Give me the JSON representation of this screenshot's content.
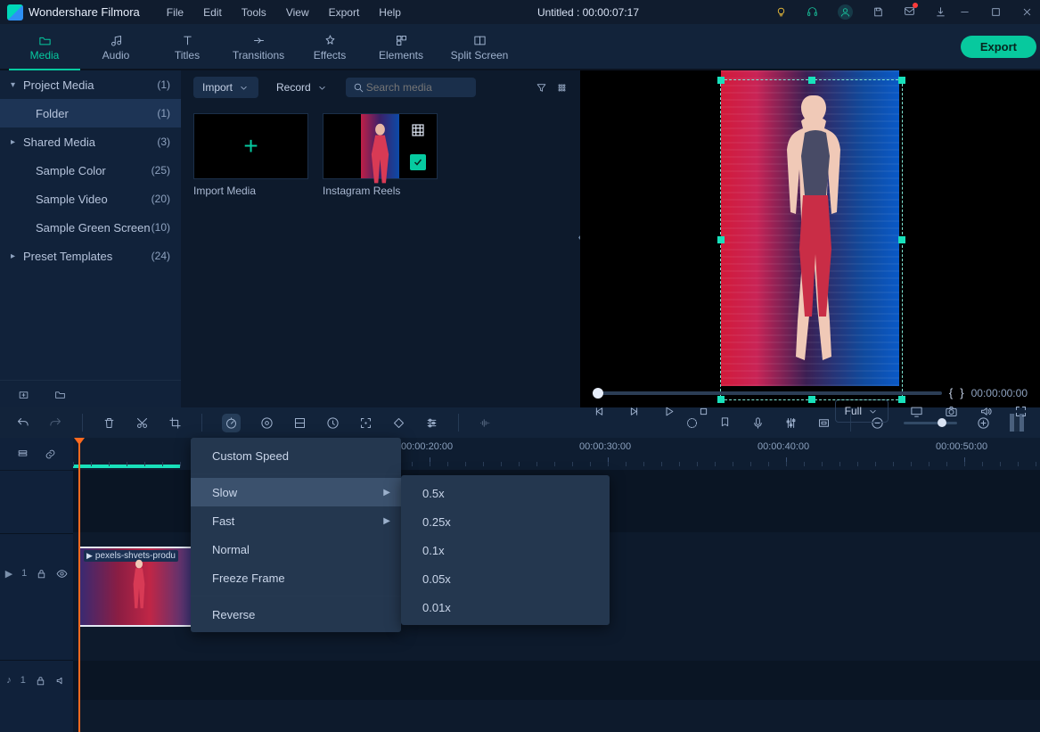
{
  "app_name": "Wondershare Filmora",
  "menus": [
    "File",
    "Edit",
    "Tools",
    "View",
    "Export",
    "Help"
  ],
  "project_title": "Untitled : 00:00:07:17",
  "cats": [
    {
      "label": "Media",
      "active": true
    },
    {
      "label": "Audio"
    },
    {
      "label": "Titles"
    },
    {
      "label": "Transitions"
    },
    {
      "label": "Effects"
    },
    {
      "label": "Elements"
    },
    {
      "label": "Split Screen"
    }
  ],
  "export_label": "Export",
  "leftpanel": [
    {
      "tri": "▾",
      "name": "Project Media",
      "count": "(1)",
      "hdr": true
    },
    {
      "tri": "",
      "name": "Folder",
      "count": "(1)",
      "sub": true,
      "sel": true
    },
    {
      "tri": "▸",
      "name": "Shared Media",
      "count": "(3)",
      "hdr": true
    },
    {
      "tri": "",
      "name": "Sample Color",
      "count": "(25)",
      "sub": true
    },
    {
      "tri": "",
      "name": "Sample Video",
      "count": "(20)",
      "sub": true
    },
    {
      "tri": "",
      "name": "Sample Green Screen",
      "count": "(10)",
      "sub": true
    },
    {
      "tri": "▸",
      "name": "Preset Templates",
      "count": "(24)",
      "hdr": true
    }
  ],
  "media_bar": {
    "import": "Import",
    "record": "Record",
    "search_ph": "Search media"
  },
  "thumbs": [
    {
      "type": "import",
      "label": "Import Media"
    },
    {
      "type": "clip",
      "label": "Instagram Reels"
    }
  ],
  "preview": {
    "brackets_l": "{",
    "brackets_r": "}",
    "timecode": "00:00:00:00",
    "fit": "Full"
  },
  "speed_menu": [
    "Custom Speed",
    "Slow",
    "Fast",
    "Normal",
    "Freeze Frame",
    "Reverse"
  ],
  "slow_submenu": [
    "0.5x",
    "0.25x",
    "0.1x",
    "0.05x",
    "0.01x"
  ],
  "ruler": [
    "00:00:20:00",
    "00:00:30:00",
    "00:00:40:00",
    "00:00:50:00"
  ],
  "clip_name": "pexels-shvets-produ",
  "tracks": {
    "video": "1",
    "audio": "1"
  }
}
